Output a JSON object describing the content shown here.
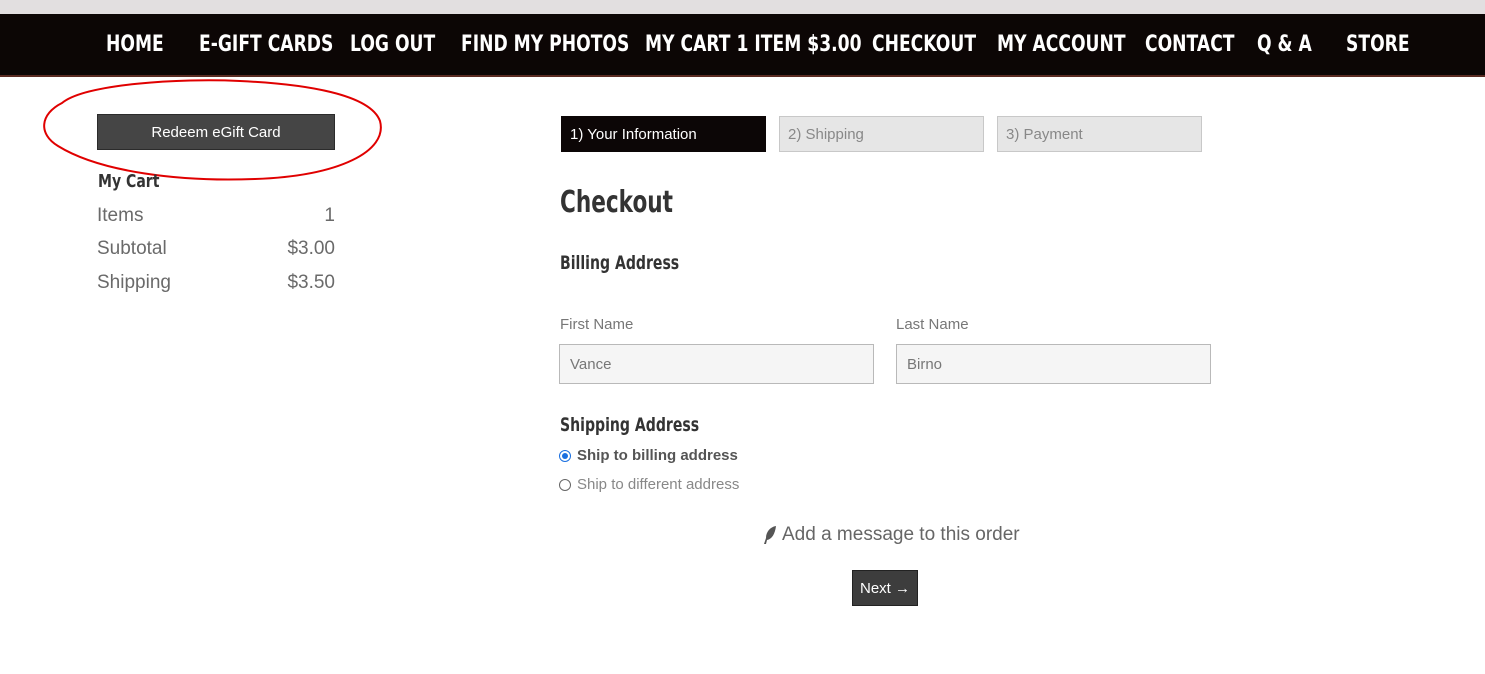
{
  "nav": {
    "items": [
      "HOME",
      "E-GIFT CARDS",
      "LOG OUT",
      "FIND MY PHOTOS",
      "MY CART 1 ITEM $3.00",
      "CHECKOUT",
      "MY ACCOUNT",
      "CONTACT",
      "Q & A",
      "STORE"
    ]
  },
  "sidebar": {
    "redeem_label": "Redeem eGift Card",
    "cart_title": "My Cart",
    "rows": [
      {
        "label": "Items",
        "value": "1"
      },
      {
        "label": "Subtotal",
        "value": "$3.00"
      },
      {
        "label": "Shipping",
        "value": "$3.50"
      }
    ]
  },
  "steps": [
    "1) Your Information",
    "2) Shipping",
    "3) Payment"
  ],
  "main": {
    "title": "Checkout",
    "billing_heading": "Billing Address",
    "first_name_label": "First Name",
    "first_name_value": "Vance",
    "last_name_label": "Last Name",
    "last_name_value": "Birno",
    "shipping_heading": "Shipping Address",
    "ship_billing": "Ship to billing address",
    "ship_different": "Ship to different address",
    "message_link": "Add a message to this order",
    "next_label": "Next →"
  },
  "annotation": {
    "circle_color": "#e00000",
    "highlighted": "redeem-egift-card-button"
  },
  "colors": {
    "nav_bg": "#0c0605",
    "active_step_bg": "#0c0606",
    "radio_accent": "#1a6fe0"
  }
}
